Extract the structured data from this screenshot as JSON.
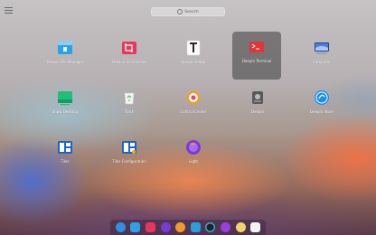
{
  "search": {
    "placeholder": "Search"
  },
  "apps": [
    {
      "label": "Deepin File Manager",
      "icon": "file-manager-icon"
    },
    {
      "label": "Deepin Screenshot",
      "icon": "screenshot-icon"
    },
    {
      "label": "Deepin Editor",
      "icon": "text-editor-icon"
    },
    {
      "label": "Deepin Terminal",
      "icon": "terminal-icon",
      "selected": true
    },
    {
      "label": "Computer",
      "icon": "computer-icon"
    },
    {
      "label": "Show Desktop",
      "icon": "show-desktop-icon"
    },
    {
      "label": "Trash",
      "icon": "trash-icon"
    },
    {
      "label": "Control Center",
      "icon": "control-center-icon"
    },
    {
      "label": "Deepin",
      "icon": "deepin-store-icon"
    },
    {
      "label": "Deepin Store",
      "icon": "deepin-app-store-icon"
    },
    {
      "label": "Tiles",
      "icon": "tiles-icon"
    },
    {
      "label": "Tiles Configuration",
      "icon": "tiles-config-icon"
    },
    {
      "label": "Light",
      "icon": "firefox-icon"
    }
  ],
  "dock": [
    "launcher-icon",
    "file-manager-icon",
    "screenshot-icon",
    "firefox-icon",
    "control-center-icon",
    "camera-icon",
    "clock-icon",
    "power-icon",
    "music-icon",
    "trash-icon"
  ]
}
